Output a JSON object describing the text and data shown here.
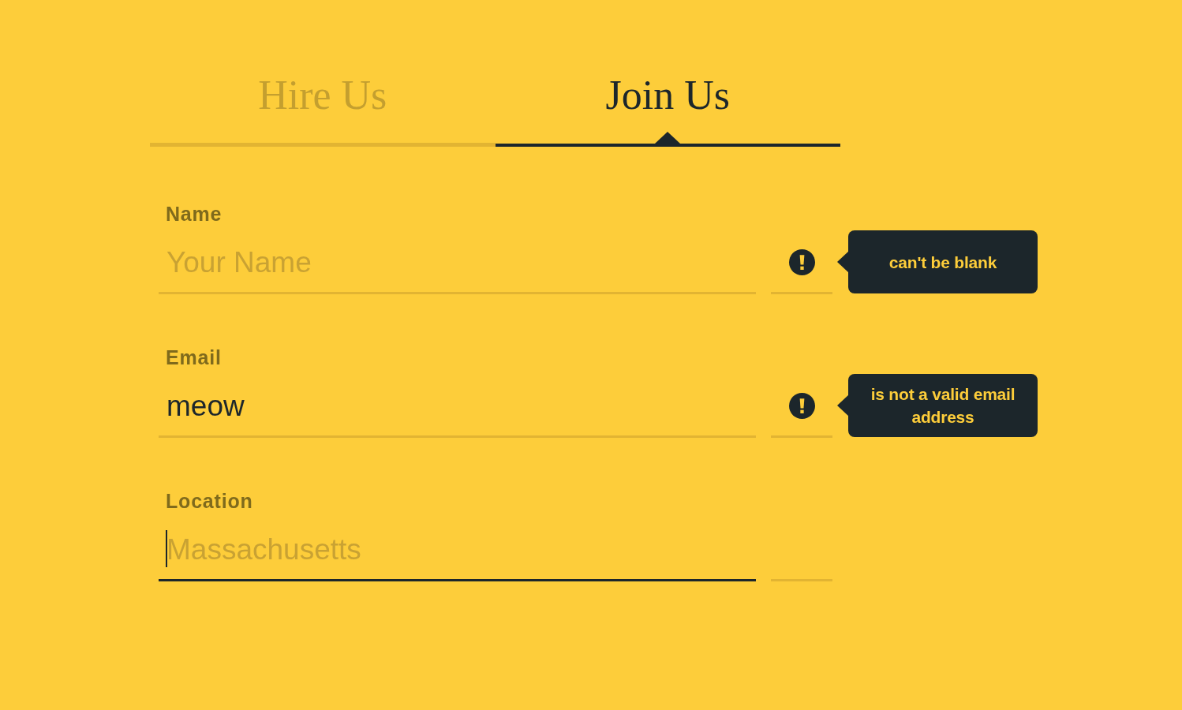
{
  "tabs": [
    {
      "label": "Hire Us",
      "selected": false
    },
    {
      "label": "Join Us",
      "selected": true
    }
  ],
  "form": {
    "fields": [
      {
        "label": "Name",
        "placeholder": "Your Name",
        "focused": false,
        "error": "can't be blank"
      },
      {
        "label": "Email",
        "value": "meow",
        "focused": false,
        "error": "is not a valid email address"
      },
      {
        "label": "Location",
        "placeholder": "Massachusetts",
        "focused": true
      }
    ]
  }
}
